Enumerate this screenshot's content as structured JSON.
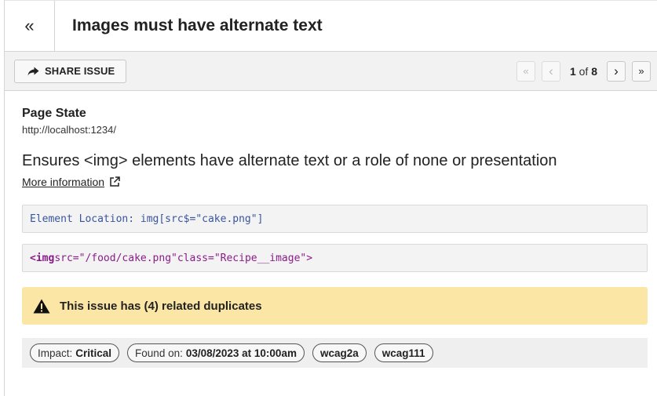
{
  "header": {
    "back_icon": "«",
    "title": "Images must have alternate text"
  },
  "toolbar": {
    "share_label": "SHARE ISSUE",
    "pager": {
      "first_icon": "«",
      "prev_icon": "‹",
      "current": "1",
      "of_text": "of",
      "total": "8",
      "next_icon": "›",
      "last_icon": "»"
    }
  },
  "page_state": {
    "label": "Page State",
    "url": "http://localhost:1234/"
  },
  "rule": {
    "description": "Ensures <img> elements have alternate text or a role of none or presentation",
    "more_info_label": "More information"
  },
  "element": {
    "location": "Element Location: img[src$=\"cake.png\"]",
    "html_tag": "<img",
    "html_attr_src": " src=",
    "html_val_src": "\"/food/cake.png\"",
    "html_attr_class": " class=",
    "html_val_class": "\"Recipe__image\"",
    "html_close": ">"
  },
  "duplicates": {
    "text": "This issue has (4) related duplicates"
  },
  "tags": {
    "impact_label": "Impact:",
    "impact_value": "Critical",
    "found_label": "Found on:",
    "found_value": "03/08/2023 at 10:00am",
    "items": [
      "wcag2a",
      "wcag111"
    ]
  },
  "colors": {
    "warning_bg": "#fbe6a6",
    "code_blue": "#3a55a0",
    "code_purple": "#8a1c8a"
  }
}
